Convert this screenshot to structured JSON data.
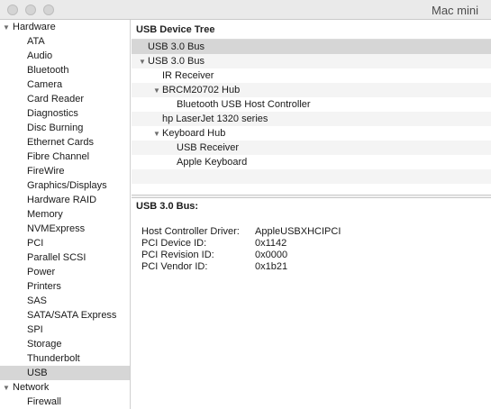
{
  "window": {
    "title": "Mac mini"
  },
  "sidebar": {
    "groups": [
      {
        "label": "Hardware",
        "items": [
          "ATA",
          "Audio",
          "Bluetooth",
          "Camera",
          "Card Reader",
          "Diagnostics",
          "Disc Burning",
          "Ethernet Cards",
          "Fibre Channel",
          "FireWire",
          "Graphics/Displays",
          "Hardware RAID",
          "Memory",
          "NVMExpress",
          "PCI",
          "Parallel SCSI",
          "Power",
          "Printers",
          "SAS",
          "SATA/SATA Express",
          "SPI",
          "Storage",
          "Thunderbolt",
          "USB"
        ]
      },
      {
        "label": "Network",
        "items": [
          "Firewall"
        ]
      }
    ],
    "selected": "USB"
  },
  "tree": {
    "header": "USB Device Tree",
    "rows": [
      {
        "label": "USB 3.0 Bus",
        "level": 0,
        "expander": false,
        "selected": true
      },
      {
        "label": "USB 3.0 Bus",
        "level": 0,
        "expander": true,
        "selected": false
      },
      {
        "label": "IR Receiver",
        "level": 1,
        "expander": false,
        "selected": false
      },
      {
        "label": "BRCM20702 Hub",
        "level": 1,
        "expander": true,
        "selected": false
      },
      {
        "label": "Bluetooth USB Host Controller",
        "level": 2,
        "expander": false,
        "selected": false
      },
      {
        "label": "hp LaserJet 1320 series",
        "level": 1,
        "expander": false,
        "selected": false
      },
      {
        "label": "Keyboard Hub",
        "level": 1,
        "expander": true,
        "selected": false
      },
      {
        "label": "USB Receiver",
        "level": 2,
        "expander": false,
        "selected": false
      },
      {
        "label": "Apple Keyboard",
        "level": 2,
        "expander": false,
        "selected": false
      },
      {
        "label": "",
        "level": 0,
        "expander": false,
        "selected": false
      }
    ]
  },
  "detail": {
    "title": "USB 3.0 Bus:",
    "properties": [
      {
        "key": "Host Controller Driver:",
        "value": "AppleUSBXHCIPCI"
      },
      {
        "key": "PCI Device ID:",
        "value": "0x1142"
      },
      {
        "key": "PCI Revision ID:",
        "value": "0x0000"
      },
      {
        "key": "PCI Vendor ID:",
        "value": "0x1b21"
      }
    ]
  }
}
